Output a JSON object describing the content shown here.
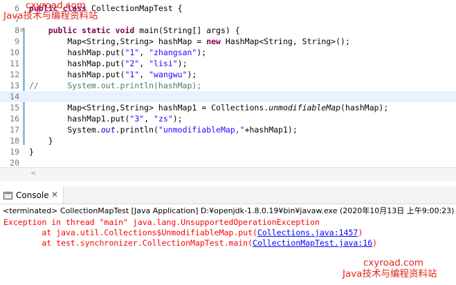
{
  "editor": {
    "gutter_marker_color": "#3f7fbf",
    "lines": [
      {
        "num": "6",
        "fold": "",
        "cls": "",
        "segs": [
          {
            "t": "public class ",
            "c": "kw"
          },
          {
            "t": "CollectionMapTest {",
            "c": ""
          }
        ]
      },
      {
        "num": "7",
        "fold": "",
        "cls": "",
        "segs": []
      },
      {
        "num": "8",
        "fold": "⊖",
        "cls": "",
        "segs": [
          {
            "t": "    ",
            "c": ""
          },
          {
            "t": "public static void ",
            "c": "kw"
          },
          {
            "t": "main(String[] args) {",
            "c": ""
          }
        ]
      },
      {
        "num": "9",
        "fold": "",
        "cls": "",
        "segs": [
          {
            "t": "        Map<String,String> ",
            "c": ""
          },
          {
            "t": "hashMap",
            "c": ""
          },
          {
            "t": " = ",
            "c": ""
          },
          {
            "t": "new ",
            "c": "kw"
          },
          {
            "t": "HashMap<String, String>();",
            "c": ""
          }
        ]
      },
      {
        "num": "10",
        "fold": "",
        "cls": "",
        "segs": [
          {
            "t": "        hashMap.put(",
            "c": ""
          },
          {
            "t": "\"1\"",
            "c": "str"
          },
          {
            "t": ", ",
            "c": ""
          },
          {
            "t": "\"zhangsan\"",
            "c": "str"
          },
          {
            "t": ");",
            "c": ""
          }
        ]
      },
      {
        "num": "11",
        "fold": "",
        "cls": "",
        "segs": [
          {
            "t": "        hashMap.put(",
            "c": ""
          },
          {
            "t": "\"2\"",
            "c": "str"
          },
          {
            "t": ", ",
            "c": ""
          },
          {
            "t": "\"lisi\"",
            "c": "str"
          },
          {
            "t": ");",
            "c": ""
          }
        ]
      },
      {
        "num": "12",
        "fold": "",
        "cls": "",
        "segs": [
          {
            "t": "        hashMap.put(",
            "c": ""
          },
          {
            "t": "\"1\"",
            "c": "str"
          },
          {
            "t": ", ",
            "c": ""
          },
          {
            "t": "\"wangwu\"",
            "c": "str"
          },
          {
            "t": ");",
            "c": ""
          }
        ]
      },
      {
        "num": "13",
        "fold": "",
        "cls": "",
        "segs": [
          {
            "t": "//      System.out.println(hashMap);",
            "c": "cm"
          }
        ]
      },
      {
        "num": "14",
        "fold": "",
        "cls": "cur-line",
        "segs": []
      },
      {
        "num": "15",
        "fold": "",
        "cls": "",
        "segs": [
          {
            "t": "        Map<String,String> hashMap1 = Collections.",
            "c": ""
          },
          {
            "t": "unmodifiableMap",
            "c": "it"
          },
          {
            "t": "(hashMap);",
            "c": ""
          }
        ]
      },
      {
        "num": "16",
        "fold": "",
        "cls": "",
        "segs": [
          {
            "t": "        hashMap1.put(",
            "c": ""
          },
          {
            "t": "\"3\"",
            "c": "str"
          },
          {
            "t": ", ",
            "c": ""
          },
          {
            "t": "\"zs\"",
            "c": "str"
          },
          {
            "t": ");",
            "c": ""
          }
        ]
      },
      {
        "num": "17",
        "fold": "",
        "cls": "",
        "segs": [
          {
            "t": "        System.",
            "c": ""
          },
          {
            "t": "out",
            "c": "fld it"
          },
          {
            "t": ".println(",
            "c": ""
          },
          {
            "t": "\"unmodifiableMap,\"",
            "c": "str"
          },
          {
            "t": "+hashMap1);",
            "c": ""
          }
        ]
      },
      {
        "num": "18",
        "fold": "",
        "cls": "",
        "segs": [
          {
            "t": "    }",
            "c": ""
          }
        ]
      },
      {
        "num": "19",
        "fold": "",
        "cls": "",
        "segs": [
          {
            "t": "}",
            "c": ""
          }
        ]
      },
      {
        "num": "20",
        "fold": "",
        "cls": "",
        "segs": []
      }
    ]
  },
  "watermark": {
    "top_url": "cxyroad.com",
    "top_text": "Java技术与编程资料站",
    "bottom_url": "cxyroad.com",
    "bottom_text": "Java技术与编程资料站",
    "color": "#e2231a"
  },
  "console": {
    "tab_label": "Console",
    "tab_icon": "console-icon",
    "close_glyph": "✕",
    "status": "<terminated> CollectionMapTest [Java Application] D:¥openjdk-1.8.0.19¥bin¥javaw.exe (2020年10月13日 上午9:00:23)",
    "error_lines": [
      {
        "pre": "Exception in thread \"main\" java.lang.UnsupportedOperationException",
        "link": "",
        "post": ""
      },
      {
        "pre": "\tat java.util.Collections$UnmodifiableMap.put(",
        "link": "Collections.java:1457",
        "post": ")"
      },
      {
        "pre": "\tat test.synchronizer.CollectionMapTest.main(",
        "link": "CollectionMapTest.java:16",
        "post": ")"
      }
    ],
    "error_color": "#ff0000"
  }
}
